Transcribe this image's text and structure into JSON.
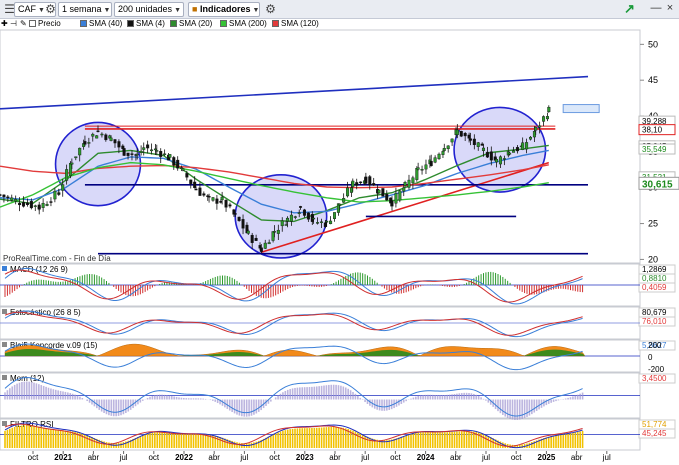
{
  "toolbar": {
    "symbol": "CAF",
    "period": "1 semana",
    "units": "200 unidades",
    "indicators": "Indicadores"
  },
  "legend": [
    {
      "label": "Precio",
      "color": "#ffffff"
    },
    {
      "label": "SMA (40)",
      "color": "#3a7fd8"
    },
    {
      "label": "SMA (4)",
      "color": "#111111"
    },
    {
      "label": "SMA (20)",
      "color": "#2e8b2e"
    },
    {
      "label": "SMA (200)",
      "color": "#36c236"
    },
    {
      "label": "SMA (120)",
      "color": "#e23b3b"
    }
  ],
  "source_label": "ProRealTime.com - Fin de Día",
  "chart_data": {
    "type": "line",
    "title": "",
    "price_axis": {
      "ticks": [
        20,
        25,
        30,
        35,
        40,
        45,
        50
      ],
      "range": [
        19.5,
        52
      ]
    },
    "price_labels": [
      {
        "value": "39,288",
        "price": 39.288,
        "style": "plain"
      },
      {
        "value": "38,10",
        "price": 38.1,
        "style": "boxed-red"
      },
      {
        "value": "35,845",
        "price": 35.845,
        "style": "plain"
      },
      {
        "value": "35,549",
        "price": 35.4,
        "style": "green"
      },
      {
        "value": "31,521",
        "price": 31.521,
        "style": "green"
      },
      {
        "value": "30,615",
        "price": 30.615,
        "style": "bold-green"
      }
    ],
    "time_axis": [
      "oct",
      "2021",
      "abr",
      "jul",
      "oct",
      "2022",
      "abr",
      "jul",
      "oct",
      "2023",
      "abr",
      "jul",
      "oct",
      "2024",
      "abr",
      "jul",
      "oct",
      "2025",
      "abr",
      "jul"
    ],
    "time_axis_bold": [
      "2021",
      "2022",
      "2023",
      "2024",
      "2025"
    ],
    "series": [
      {
        "name": "Precio",
        "color": "#000000",
        "points": [
          [
            0,
            29
          ],
          [
            3,
            28
          ],
          [
            6,
            27.3
          ],
          [
            9,
            29.4
          ],
          [
            11,
            33.8
          ],
          [
            13,
            36.5
          ],
          [
            15,
            37.8
          ],
          [
            17,
            36.8
          ],
          [
            19,
            35
          ],
          [
            21,
            34.5
          ],
          [
            22,
            35.6
          ],
          [
            24,
            35.2
          ],
          [
            26,
            34.1
          ],
          [
            28,
            32.2
          ],
          [
            30,
            29.8
          ],
          [
            32,
            28.3
          ],
          [
            34,
            28.2
          ],
          [
            36,
            26
          ],
          [
            38,
            23.5
          ],
          [
            40,
            21.4
          ],
          [
            42,
            24
          ],
          [
            44,
            25.6
          ],
          [
            46,
            27.2
          ],
          [
            48,
            25.3
          ],
          [
            50,
            25
          ],
          [
            52,
            27.8
          ],
          [
            54,
            30.5
          ],
          [
            56,
            31.2
          ],
          [
            58,
            29.5
          ],
          [
            60,
            28
          ],
          [
            62,
            30.2
          ],
          [
            64,
            32.4
          ],
          [
            66,
            33.6
          ],
          [
            68,
            35.7
          ],
          [
            70,
            37.9
          ],
          [
            72,
            36.5
          ],
          [
            74,
            35.2
          ],
          [
            76,
            33.7
          ],
          [
            78,
            35.1
          ],
          [
            80,
            35.7
          ],
          [
            82,
            38.1
          ],
          [
            84,
            40.8
          ]
        ]
      },
      {
        "name": "SMA (20)",
        "color": "#2e8b2e",
        "points": [
          [
            0,
            28.4
          ],
          [
            5,
            27.8
          ],
          [
            10,
            31
          ],
          [
            15,
            34.8
          ],
          [
            20,
            35.2
          ],
          [
            25,
            34.5
          ],
          [
            30,
            31.2
          ],
          [
            35,
            28.3
          ],
          [
            40,
            25.5
          ],
          [
            45,
            25.3
          ],
          [
            50,
            26.8
          ],
          [
            55,
            28.6
          ],
          [
            60,
            29.3
          ],
          [
            65,
            31.1
          ],
          [
            70,
            33.1
          ],
          [
            75,
            34.9
          ],
          [
            80,
            35.4
          ],
          [
            84,
            35.9
          ]
        ]
      },
      {
        "name": "SMA (40)",
        "color": "#3a7fd8",
        "points": [
          [
            0,
            28.6
          ],
          [
            5,
            28.3
          ],
          [
            10,
            30
          ],
          [
            15,
            33
          ],
          [
            20,
            34.3
          ],
          [
            25,
            34.1
          ],
          [
            30,
            32.6
          ],
          [
            35,
            30.1
          ],
          [
            40,
            27.7
          ],
          [
            45,
            26.5
          ],
          [
            50,
            26.7
          ],
          [
            55,
            27.8
          ],
          [
            60,
            29
          ],
          [
            65,
            30.3
          ],
          [
            70,
            32
          ],
          [
            75,
            33.4
          ],
          [
            80,
            34.5
          ],
          [
            84,
            35.2
          ]
        ]
      },
      {
        "name": "SMA (120)",
        "color": "#e23b3b",
        "points": [
          [
            0,
            33
          ],
          [
            5,
            32.3
          ],
          [
            10,
            32
          ],
          [
            15,
            32.7
          ],
          [
            20,
            33
          ],
          [
            25,
            33.1
          ],
          [
            30,
            32.8
          ],
          [
            35,
            32.2
          ],
          [
            40,
            31.4
          ],
          [
            45,
            30.6
          ],
          [
            50,
            30.1
          ],
          [
            55,
            30
          ],
          [
            60,
            30.1
          ],
          [
            65,
            30.6
          ],
          [
            70,
            31.2
          ],
          [
            75,
            31.8
          ],
          [
            80,
            32.5
          ],
          [
            84,
            33.2
          ]
        ]
      },
      {
        "name": "SMA (200)",
        "color": "#36c236",
        "points": [
          [
            0,
            27.3
          ],
          [
            5,
            29
          ],
          [
            10,
            31.4
          ],
          [
            15,
            32.8
          ],
          [
            20,
            33.5
          ],
          [
            25,
            33.2
          ],
          [
            30,
            32.3
          ],
          [
            35,
            31.3
          ],
          [
            40,
            30.3
          ],
          [
            45,
            29.4
          ],
          [
            50,
            28.6
          ],
          [
            55,
            28
          ],
          [
            60,
            28.2
          ],
          [
            65,
            28.6
          ],
          [
            70,
            29
          ],
          [
            75,
            29.5
          ],
          [
            80,
            30.1
          ],
          [
            84,
            30.7
          ]
        ]
      }
    ],
    "trendlines": [
      {
        "color": "#1f2fbf",
        "from": [
          0,
          41
        ],
        "to": [
          90,
          45.5
        ]
      },
      {
        "color": "#e02020",
        "from": [
          40,
          21
        ],
        "to": [
          84,
          33.5
        ]
      },
      {
        "color": "#e02020",
        "from": [
          13,
          38.2
        ],
        "to": [
          85,
          38.2
        ]
      },
      {
        "color": "#000080",
        "from": [
          13,
          30.4
        ],
        "to": [
          90,
          30.4
        ]
      },
      {
        "color": "#000080",
        "from": [
          56,
          26
        ],
        "to": [
          79,
          26
        ]
      },
      {
        "color": "#000080",
        "from": [
          15,
          20.8
        ],
        "to": [
          90,
          20.8
        ]
      }
    ],
    "circles": [
      {
        "cx": 15,
        "cy": 33.3,
        "rx": 6.5,
        "ry": 5.8
      },
      {
        "cx": 43,
        "cy": 26,
        "rx": 7,
        "ry": 5.8
      },
      {
        "cx": 76.5,
        "cy": 35.3,
        "rx": 7,
        "ry": 5.9
      }
    ],
    "panels": [
      {
        "name": "MACD (12 26 9)",
        "values": [
          "1,2869",
          "0,8810",
          "0,4059"
        ],
        "value_colors": [
          "#000000",
          "#2e8b2e",
          "#e23b3b"
        ],
        "ticks": []
      },
      {
        "name": "Estocástico (26 8 5)",
        "values": [
          "80,679",
          "76,010"
        ],
        "value_colors": [
          "#000000",
          "#e23b3b"
        ],
        "ticks": []
      },
      {
        "name": "Blai5 Koncorde v.09 (15)",
        "values": [
          "5,8627"
        ],
        "value_colors": [
          "#3a7fd8"
        ],
        "ticks": [
          "200",
          "0",
          "-200"
        ]
      },
      {
        "name": "Mom (12)",
        "values": [
          "3,4500"
        ],
        "value_colors": [
          "#e23b3b"
        ],
        "ticks": []
      },
      {
        "name": "FILTRO RSI",
        "values": [
          "51,774",
          "45,245"
        ],
        "value_colors": [
          "#e0a000",
          "#e23b3b"
        ],
        "ticks": []
      }
    ]
  }
}
